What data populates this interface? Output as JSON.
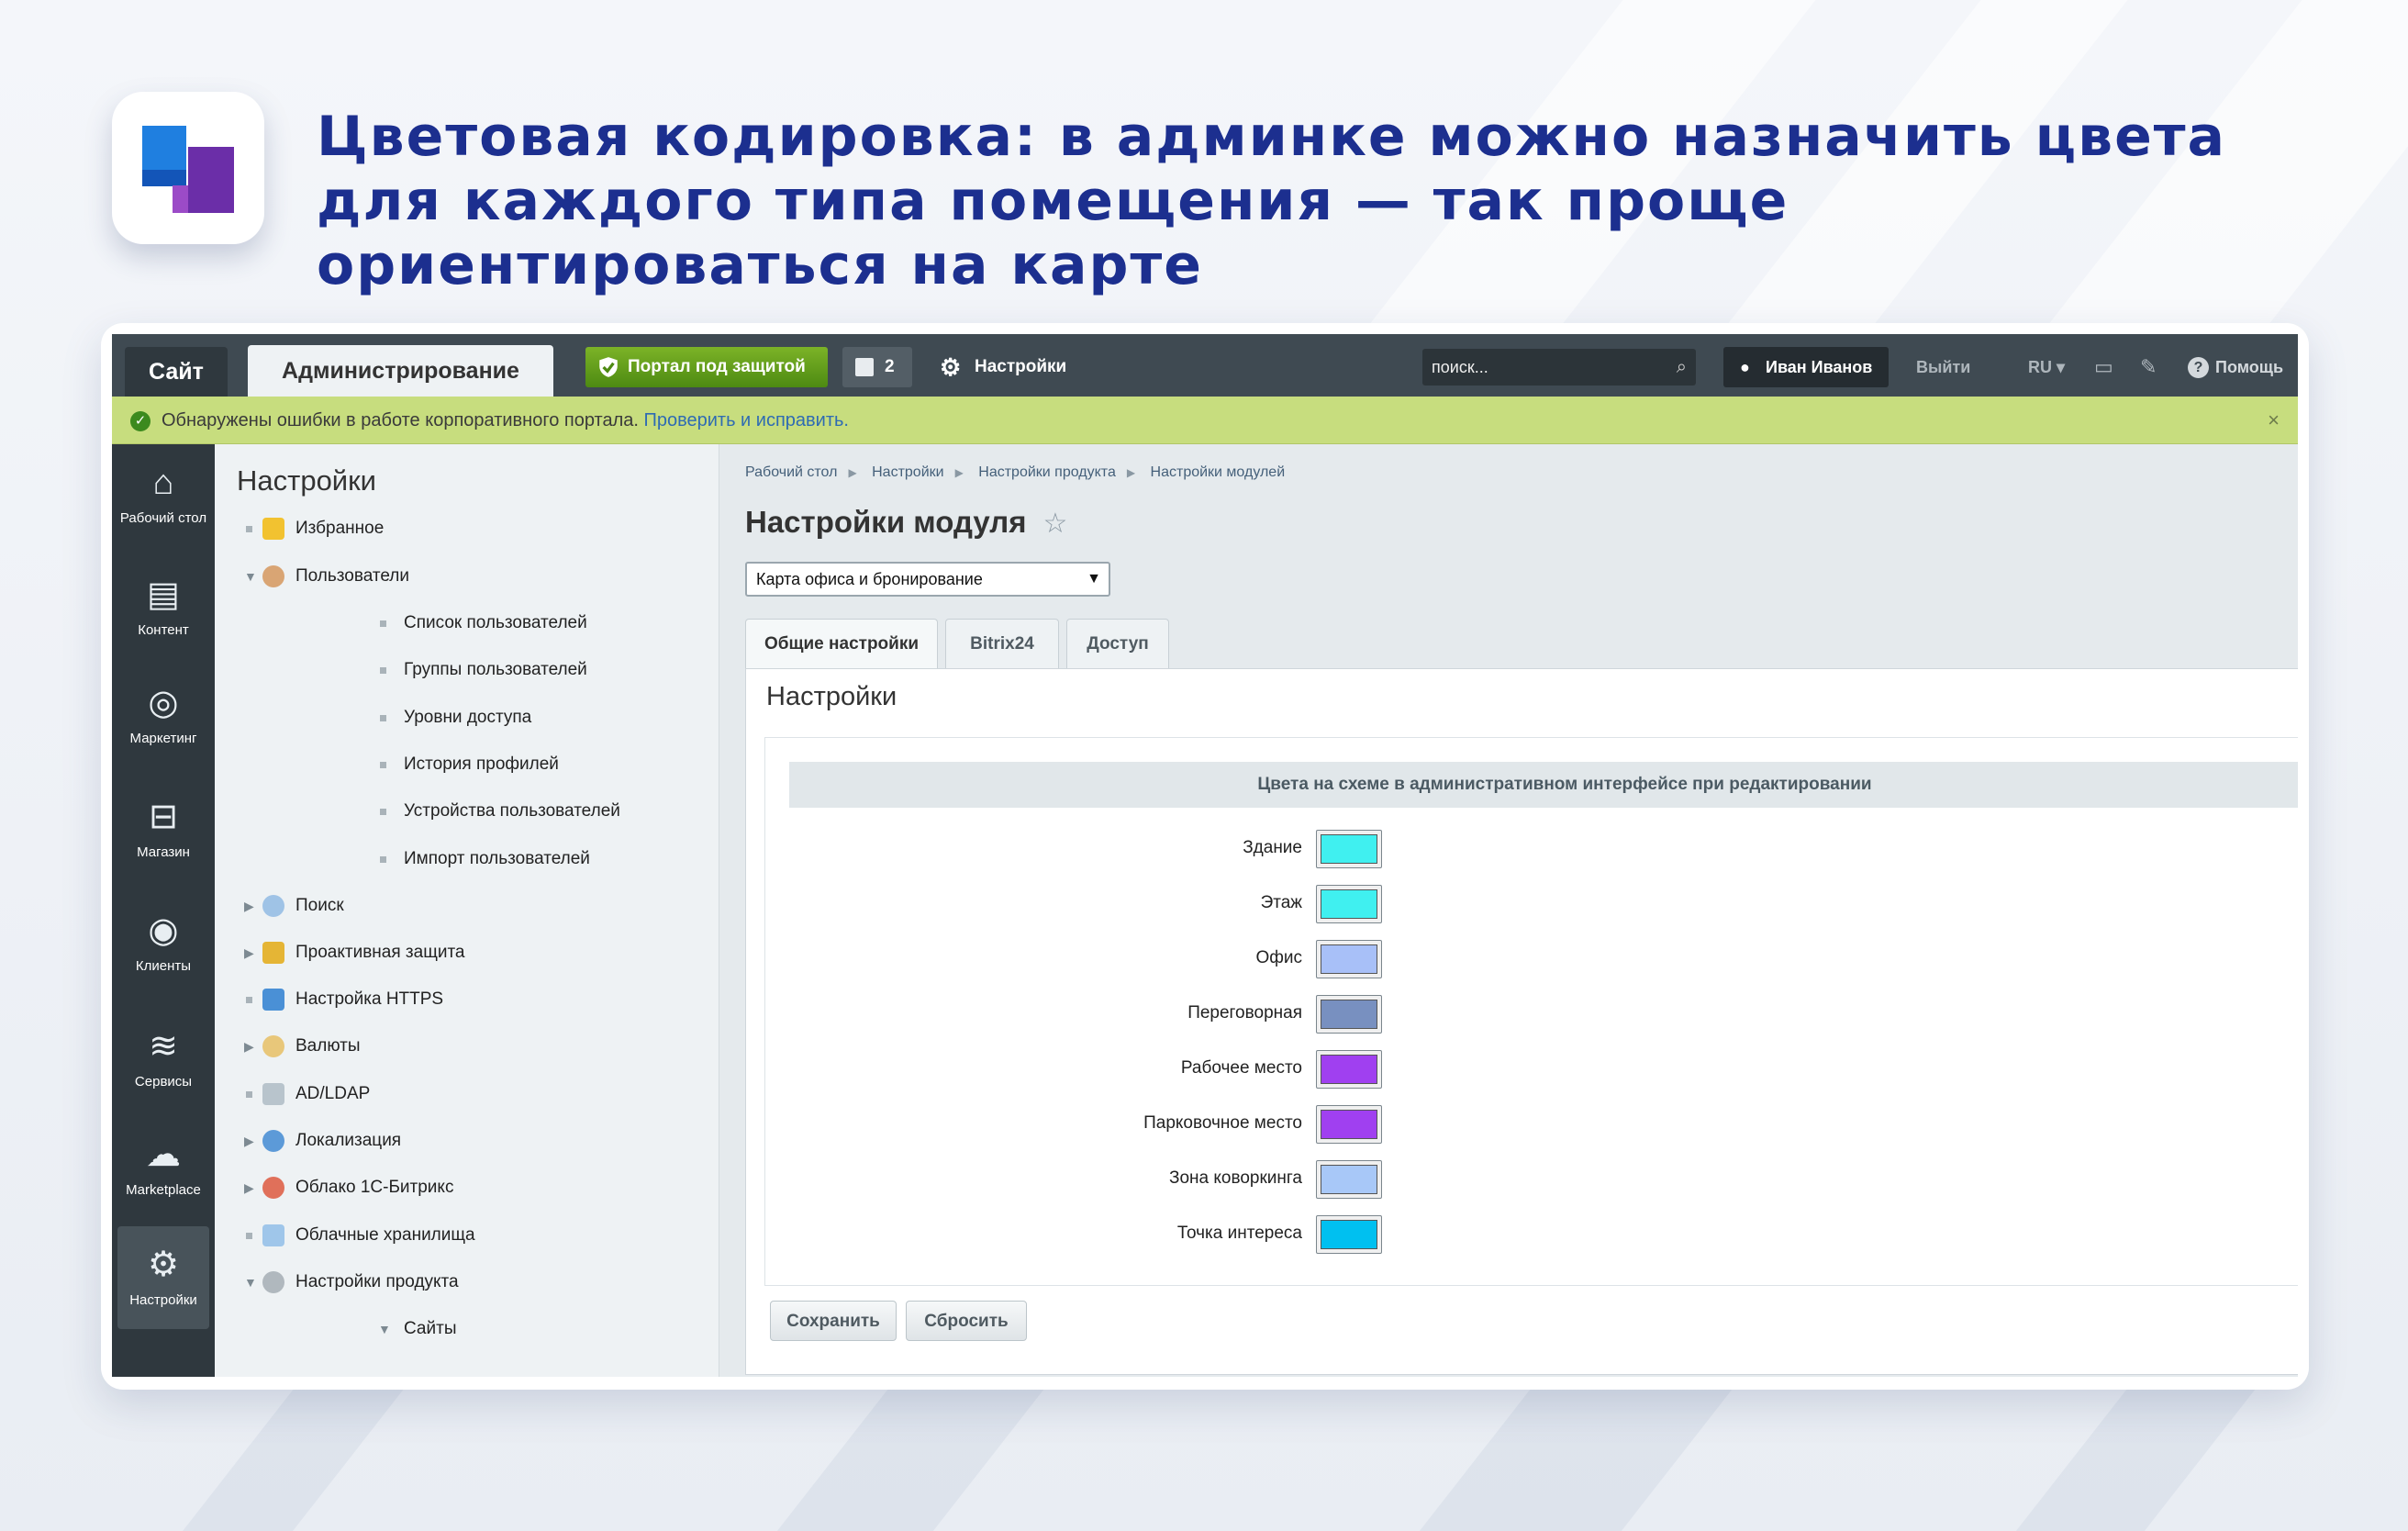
{
  "headline": "Цветовая кодировка: в админке можно назначить цвета для каждого типа помещения — так проще ориентироваться на карте",
  "topbar": {
    "site_tab": "Сайт",
    "admin_tab": "Администрирование",
    "protect_label": "Портал под защитой",
    "notifications_count": "2",
    "settings_label": "Настройки",
    "search_placeholder": "поиск...",
    "user_name": "Иван Иванов",
    "logout": "Выйти",
    "lang": "RU",
    "help": "Помощь"
  },
  "alert": {
    "message": "Обнаружены ошибки в работе корпоративного портала.",
    "link": "Проверить и исправить.",
    "close": "×"
  },
  "leftnav": [
    {
      "label": "Рабочий стол",
      "icon": "home-icon"
    },
    {
      "label": "Контент",
      "icon": "document-icon"
    },
    {
      "label": "Маркетинг",
      "icon": "target-icon"
    },
    {
      "label": "Магазин",
      "icon": "basket-icon"
    },
    {
      "label": "Клиенты",
      "icon": "clients-24-icon"
    },
    {
      "label": "Сервисы",
      "icon": "layers-icon"
    },
    {
      "label": "Marketplace",
      "icon": "cloud-download-icon"
    },
    {
      "label": "Настройки",
      "icon": "gear-icon",
      "active": true
    }
  ],
  "sidebar": {
    "title": "Настройки",
    "items": [
      {
        "label": "Избранное"
      },
      {
        "label": "Пользователи"
      },
      {
        "label": "Список пользователей"
      },
      {
        "label": "Группы пользователей"
      },
      {
        "label": "Уровни доступа"
      },
      {
        "label": "История профилей"
      },
      {
        "label": "Устройства пользователей"
      },
      {
        "label": "Импорт пользователей"
      },
      {
        "label": "Поиск"
      },
      {
        "label": "Проактивная защита"
      },
      {
        "label": "Настройка HTTPS"
      },
      {
        "label": "Валюты"
      },
      {
        "label": "AD/LDAP"
      },
      {
        "label": "Локализация"
      },
      {
        "label": "Облако 1С-Битрикс"
      },
      {
        "label": "Облачные хранилища"
      },
      {
        "label": "Настройки продукта"
      },
      {
        "label": "Сайты"
      }
    ]
  },
  "breadcrumb": [
    "Рабочий стол",
    "Настройки",
    "Настройки продукта",
    "Настройки модулей"
  ],
  "page_title": "Настройки модуля",
  "module_select": "Карта офиса и бронирование",
  "tabs": [
    "Общие настройки",
    "Bitrix24",
    "Доступ"
  ],
  "panel": {
    "title": "Настройки",
    "group_title": "Цвета на схеме в административном интерфейсе при редактировании",
    "colors": [
      {
        "label": "Здание",
        "color": "#40f0f0"
      },
      {
        "label": "Этаж",
        "color": "#40f0f0"
      },
      {
        "label": "Офис",
        "color": "#a8c0f8"
      },
      {
        "label": "Переговорная",
        "color": "#7890c0"
      },
      {
        "label": "Рабочее место",
        "color": "#a040f0"
      },
      {
        "label": "Парковочное место",
        "color": "#a040f0"
      },
      {
        "label": "Зона коворкинга",
        "color": "#a8c8f8"
      },
      {
        "label": "Точка интереса",
        "color": "#00c0f0"
      }
    ],
    "save": "Сохранить",
    "reset": "Сбросить"
  }
}
